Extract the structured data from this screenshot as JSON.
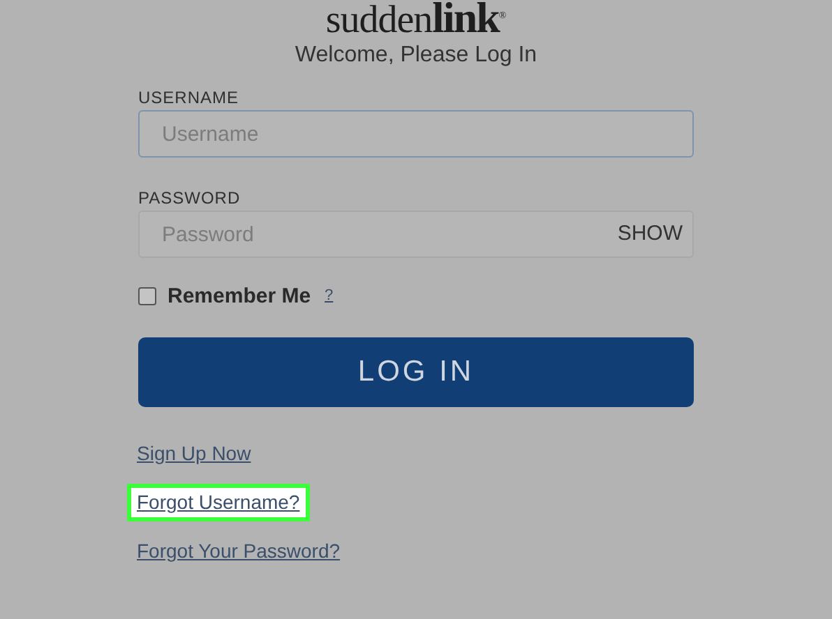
{
  "logo": {
    "parts": [
      "sudden",
      "link",
      "®"
    ]
  },
  "heading": "Welcome, Please Log In",
  "fields": [
    {
      "label": "USERNAME",
      "placeholder": "Username",
      "focused": true
    },
    {
      "label": "PASSWORD",
      "placeholder": "Password",
      "focused": false,
      "toggle": "SHOW"
    }
  ],
  "remember": {
    "label": "Remember Me",
    "checked": false,
    "help": "?"
  },
  "login_button": "LOG IN",
  "links": [
    {
      "text": "Sign Up Now",
      "highlighted": false
    },
    {
      "text": "Forgot Username?",
      "highlighted": true
    },
    {
      "text": "Forgot Your Password?",
      "highlighted": false
    }
  ]
}
